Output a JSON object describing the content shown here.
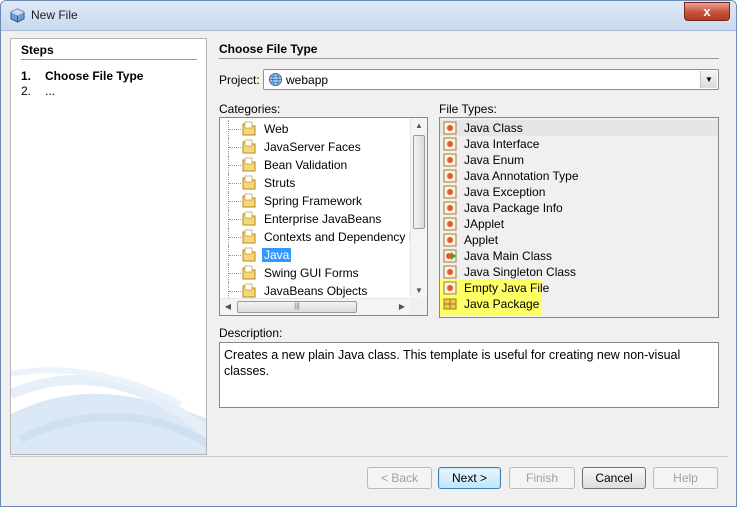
{
  "window": {
    "title": "New File",
    "close_glyph": "x"
  },
  "steps": {
    "title": "Steps",
    "items": [
      {
        "num": "1.",
        "label": "Choose File Type"
      },
      {
        "num": "2.",
        "label": "..."
      }
    ]
  },
  "main": {
    "title": "Choose File Type",
    "project_label": "Project:",
    "project_value": "webapp",
    "categories_label": "Categories:",
    "file_types_label": "File Types:",
    "categories": [
      {
        "label": "Web"
      },
      {
        "label": "JavaServer Faces"
      },
      {
        "label": "Bean Validation"
      },
      {
        "label": "Struts"
      },
      {
        "label": "Spring Framework"
      },
      {
        "label": "Enterprise JavaBeans"
      },
      {
        "label": "Contexts and Dependency Inje"
      },
      {
        "label": "Java"
      },
      {
        "label": "Swing GUI Forms"
      },
      {
        "label": "JavaBeans Objects"
      }
    ],
    "selected_category": "Java",
    "file_types": [
      {
        "label": "Java Class",
        "icon": "java-class-icon"
      },
      {
        "label": "Java Interface",
        "icon": "java-class-icon"
      },
      {
        "label": "Java Enum",
        "icon": "java-class-icon"
      },
      {
        "label": "Java Annotation Type",
        "icon": "java-class-icon"
      },
      {
        "label": "Java Exception",
        "icon": "java-class-icon"
      },
      {
        "label": "Java Package Info",
        "icon": "java-class-icon"
      },
      {
        "label": "JApplet",
        "icon": "java-class-icon"
      },
      {
        "label": "Applet",
        "icon": "java-class-icon"
      },
      {
        "label": "Java Main Class",
        "icon": "java-main-class-icon"
      },
      {
        "label": "Java Singleton Class",
        "icon": "java-class-icon"
      },
      {
        "label": "Empty Java File",
        "icon": "java-class-icon"
      },
      {
        "label": "Java Package",
        "icon": "package-icon"
      }
    ],
    "description_label": "Description:",
    "description": "Creates a new plain Java class. This template is useful for creating new non-visual classes."
  },
  "buttons": {
    "back": "< Back",
    "next": "Next >",
    "finish": "Finish",
    "cancel": "Cancel",
    "help": "Help"
  },
  "colors": {
    "selection": "#3399ff",
    "highlight": "#ffff66"
  }
}
